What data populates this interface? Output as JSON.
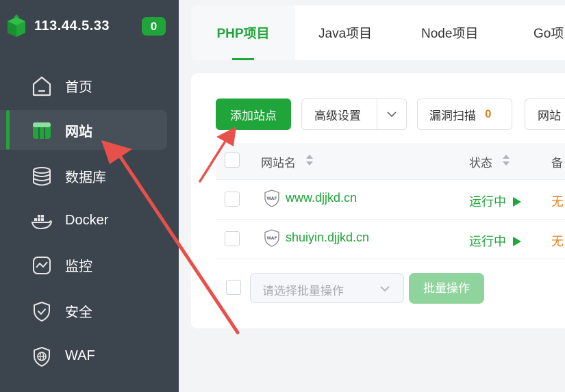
{
  "sidebar": {
    "ip": "113.44.5.33",
    "badge": "0",
    "items": [
      {
        "label": "首页",
        "icon": "home-icon"
      },
      {
        "label": "网站",
        "icon": "website-icon",
        "active": true
      },
      {
        "label": "数据库",
        "icon": "database-icon"
      },
      {
        "label": "Docker",
        "icon": "docker-icon"
      },
      {
        "label": "监控",
        "icon": "monitor-icon"
      },
      {
        "label": "安全",
        "icon": "shield-icon"
      },
      {
        "label": "WAF",
        "icon": "waf-globe-icon"
      }
    ]
  },
  "tabs": [
    "PHP项目",
    "Java项目",
    "Node项目",
    "Go项目"
  ],
  "toolbar": {
    "add_site": "添加站点",
    "advanced": "高级设置",
    "vuln_scan": "漏洞扫描",
    "vuln_count": "0",
    "site_more": "网站"
  },
  "table": {
    "headers": {
      "name": "网站名",
      "status": "状态",
      "backup": "备"
    },
    "rows": [
      {
        "name": "www.djjkd.cn",
        "status": "运行中",
        "backup": "无"
      },
      {
        "name": "shuiyin.djjkd.cn",
        "status": "运行中",
        "backup": "无"
      }
    ],
    "waf_label": "WAF"
  },
  "batch": {
    "placeholder": "请选择批量操作",
    "button": "批量操作"
  },
  "colors": {
    "accent": "#20a53a",
    "sidebar_bg": "#3c444d",
    "warning": "#e6821e",
    "annotation_arrow": "#e8504b"
  }
}
